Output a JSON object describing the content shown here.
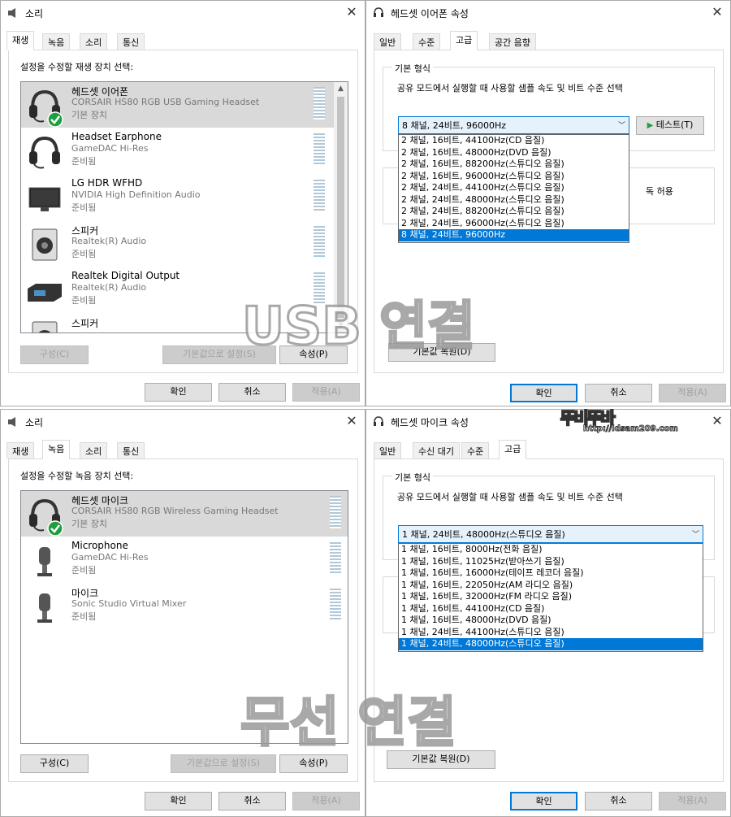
{
  "tl": {
    "title": "소리",
    "tabs": [
      "재생",
      "녹음",
      "소리",
      "통신"
    ],
    "prompt": "설정을 수정할 재생 장치 선택:",
    "devices": [
      {
        "name": "헤드셋 이어폰",
        "sub": "CORSAIR HS80 RGB USB Gaming Headset",
        "status": "기본 장치",
        "icon": "headset-icon"
      },
      {
        "name": "Headset Earphone",
        "sub": "GameDAC Hi-Res",
        "status": "준비됨",
        "icon": "headset-icon"
      },
      {
        "name": "LG HDR WFHD",
        "sub": "NVIDIA High Definition Audio",
        "status": "준비됨",
        "icon": "monitor-icon"
      },
      {
        "name": "스피커",
        "sub": "Realtek(R) Audio",
        "status": "준비됨",
        "icon": "speaker-icon"
      },
      {
        "name": "Realtek Digital Output",
        "sub": "Realtek(R) Audio",
        "status": "준비됨",
        "icon": "digital-output-icon"
      },
      {
        "name": "스피커",
        "sub": "",
        "status": "",
        "icon": "speaker-icon"
      }
    ],
    "configure": "구성(C)",
    "set_default": "기본값으로 설정(S)",
    "properties": "속성(P)",
    "ok": "확인",
    "cancel": "취소",
    "apply": "적용(A)"
  },
  "tr": {
    "title": "헤드셋 이어폰 속성",
    "tabs": [
      "일반",
      "수준",
      "고급",
      "공간 음향"
    ],
    "group_label": "기본 형식",
    "desc": "공유 모드에서 실행할 때 사용할 샘플 속도 및 비트 수준 선택",
    "combo_value": "8 채널, 24비트, 96000Hz",
    "test": "테스트(T)",
    "options": [
      "2 채널, 16비트, 44100Hz(CD 음질)",
      "2 채널, 16비트, 48000Hz(DVD 음질)",
      "2 채널, 16비트, 88200Hz(스튜디오 음질)",
      "2 채널, 16비트, 96000Hz(스튜디오 음질)",
      "2 채널, 24비트, 44100Hz(스튜디오 음질)",
      "2 채널, 24비트, 48000Hz(스튜디오 음질)",
      "2 채널, 24비트, 88200Hz(스튜디오 음질)",
      "2 채널, 24비트, 96000Hz(스튜디오 음질)",
      "8 채널, 24비트, 96000Hz"
    ],
    "group2_partial": "독 허용",
    "restore": "기본값 복원(D)",
    "ok": "확인",
    "cancel": "취소",
    "apply": "적용(A)"
  },
  "bl": {
    "title": "소리",
    "tabs": [
      "재생",
      "녹음",
      "소리",
      "통신"
    ],
    "prompt": "설정을 수정할 녹음 장치 선택:",
    "devices": [
      {
        "name": "헤드셋 마이크",
        "sub": "CORSAIR HS80 RGB Wireless Gaming Headset",
        "status": "기본 장치",
        "icon": "headset-icon"
      },
      {
        "name": "Microphone",
        "sub": "GameDAC Hi-Res",
        "status": "준비됨",
        "icon": "microphone-icon"
      },
      {
        "name": "마이크",
        "sub": "Sonic Studio Virtual Mixer",
        "status": "준비됨",
        "icon": "microphone-icon"
      }
    ],
    "configure": "구성(C)",
    "set_default": "기본값으로 설정(S)",
    "properties": "속성(P)",
    "ok": "확인",
    "cancel": "취소",
    "apply": "적용(A)"
  },
  "br": {
    "title": "헤드셋 마이크 속성",
    "tabs": [
      "일반",
      "수신 대기",
      "수준",
      "고급"
    ],
    "group_label": "기본 형식",
    "desc": "공유 모드에서 실행할 때 사용할 샘플 속도 및 비트 수준 선택",
    "combo_value": "1 채널, 24비트, 48000Hz(스튜디오 음질)",
    "options": [
      "1 채널, 16비트, 8000Hz(전화 음질)",
      "1 채널, 16비트, 11025Hz(받아쓰기 음질)",
      "1 채널, 16비트, 16000Hz(테이프 레코더 음질)",
      "1 채널, 16비트, 22050Hz(AM 라디오 음질)",
      "1 채널, 16비트, 32000Hz(FM 라디오 음질)",
      "1 채널, 16비트, 44100Hz(CD 음질)",
      "1 채널, 16비트, 48000Hz(DVD 음질)",
      "1 채널, 24비트, 44100Hz(스튜디오 음질)",
      "1 채널, 24비트, 48000Hz(스튜디오 음질)"
    ],
    "restore": "기본값 복원(D)",
    "ok": "확인",
    "cancel": "취소",
    "apply": "적용(A)"
  },
  "watermarks": {
    "top": "USB 연결",
    "bottom": "무선 연결",
    "site": "뚜비뚜바",
    "url": "http://ldsam209.com"
  },
  "colors": {
    "accent": "#0078d7",
    "selection_bg": "#cce8ff",
    "check_green": "#1f9e3f"
  }
}
